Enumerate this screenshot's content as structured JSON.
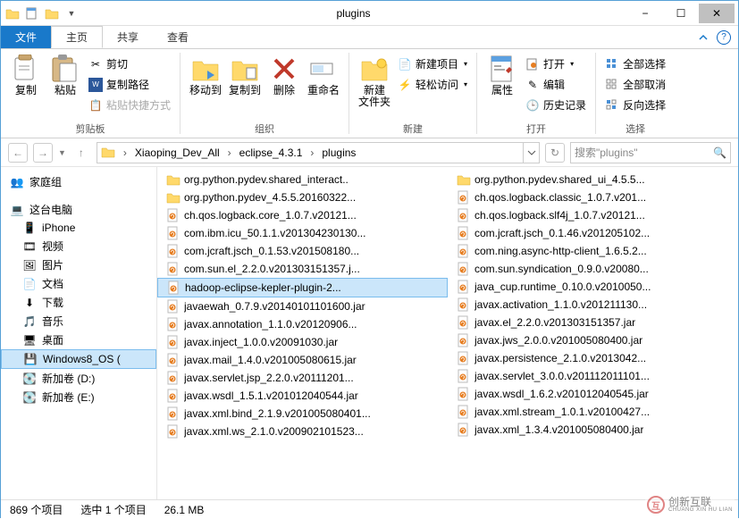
{
  "window": {
    "title": "plugins"
  },
  "tabs": {
    "file": "文件",
    "home": "主页",
    "share": "共享",
    "view": "查看"
  },
  "ribbon": {
    "groups": {
      "clipboard": "剪贴板",
      "organize": "组织",
      "new": "新建",
      "open": "打开",
      "select": "选择"
    },
    "copy": "复制",
    "paste": "粘贴",
    "cut": "剪切",
    "copypath": "复制路径",
    "pasteshortcut": "粘贴快捷方式",
    "moveto": "移动到",
    "copyto": "复制到",
    "delete": "删除",
    "rename": "重命名",
    "newfolder": "新建\n文件夹",
    "newitem": "新建项目",
    "easyaccess": "轻松访问",
    "props": "属性",
    "openbtn": "打开",
    "edit": "编辑",
    "history": "历史记录",
    "selectall": "全部选择",
    "selectnone": "全部取消",
    "invertselect": "反向选择"
  },
  "breadcrumbs": [
    "Xiaoping_Dev_All",
    "eclipse_4.3.1",
    "plugins"
  ],
  "search": {
    "placeholder": "搜索\"plugins\""
  },
  "sidebar": {
    "homegroup": "家庭组",
    "thispc": "这台电脑",
    "iphone": "iPhone",
    "videos": "视频",
    "pictures": "图片",
    "documents": "文档",
    "downloads": "下载",
    "music": "音乐",
    "desktop": "桌面",
    "os": "Windows8_OS (",
    "newvol_d": "新加卷 (D:)",
    "newvol_e": "新加卷 (E:)"
  },
  "files_col1": [
    {
      "type": "folder",
      "name": "org.python.pydev.shared_interact.."
    },
    {
      "type": "folder",
      "name": "org.python.pydev_4.5.5.20160322..."
    },
    {
      "type": "jar",
      "name": "ch.qos.logback.core_1.0.7.v20121..."
    },
    {
      "type": "jar",
      "name": "com.ibm.icu_50.1.1.v201304230130..."
    },
    {
      "type": "jar",
      "name": "com.jcraft.jsch_0.1.53.v201508180..."
    },
    {
      "type": "jar",
      "name": "com.sun.el_2.2.0.v201303151357.j..."
    },
    {
      "type": "jar",
      "name": "hadoop-eclipse-kepler-plugin-2...",
      "selected": true
    },
    {
      "type": "jar",
      "name": "javaewah_0.7.9.v20140101101600.jar"
    },
    {
      "type": "jar",
      "name": "javax.annotation_1.1.0.v20120906..."
    },
    {
      "type": "jar",
      "name": "javax.inject_1.0.0.v20091030.jar"
    },
    {
      "type": "jar",
      "name": "javax.mail_1.4.0.v201005080615.jar"
    },
    {
      "type": "jar",
      "name": "javax.servlet.jsp_2.2.0.v20111201..."
    },
    {
      "type": "jar",
      "name": "javax.wsdl_1.5.1.v201012040544.jar"
    },
    {
      "type": "jar",
      "name": "javax.xml.bind_2.1.9.v201005080401..."
    },
    {
      "type": "jar",
      "name": "javax.xml.ws_2.1.0.v200902101523..."
    }
  ],
  "files_col2": [
    {
      "type": "folder",
      "name": "org.python.pydev.shared_ui_4.5.5..."
    },
    {
      "type": "jar",
      "name": "ch.qos.logback.classic_1.0.7.v201..."
    },
    {
      "type": "jar",
      "name": "ch.qos.logback.slf4j_1.0.7.v20121..."
    },
    {
      "type": "jar",
      "name": "com.jcraft.jsch_0.1.46.v201205102..."
    },
    {
      "type": "jar",
      "name": "com.ning.async-http-client_1.6.5.2..."
    },
    {
      "type": "jar",
      "name": "com.sun.syndication_0.9.0.v20080..."
    },
    {
      "type": "jar",
      "name": "java_cup.runtime_0.10.0.v2010050..."
    },
    {
      "type": "jar",
      "name": "javax.activation_1.1.0.v201211130..."
    },
    {
      "type": "jar",
      "name": "javax.el_2.2.0.v201303151357.jar"
    },
    {
      "type": "jar",
      "name": "javax.jws_2.0.0.v201005080400.jar"
    },
    {
      "type": "jar",
      "name": "javax.persistence_2.1.0.v2013042..."
    },
    {
      "type": "jar",
      "name": "javax.servlet_3.0.0.v201112011101..."
    },
    {
      "type": "jar",
      "name": "javax.wsdl_1.6.2.v201012040545.jar"
    },
    {
      "type": "jar",
      "name": "javax.xml.stream_1.0.1.v20100427..."
    },
    {
      "type": "jar",
      "name": "javax.xml_1.3.4.v201005080400.jar"
    }
  ],
  "status": {
    "count": "869 个项目",
    "selected": "选中 1 个项目",
    "size": "26.1 MB"
  },
  "watermark": {
    "text1": "创新互联",
    "text2": "CHUANG XIN HU LIAN"
  }
}
